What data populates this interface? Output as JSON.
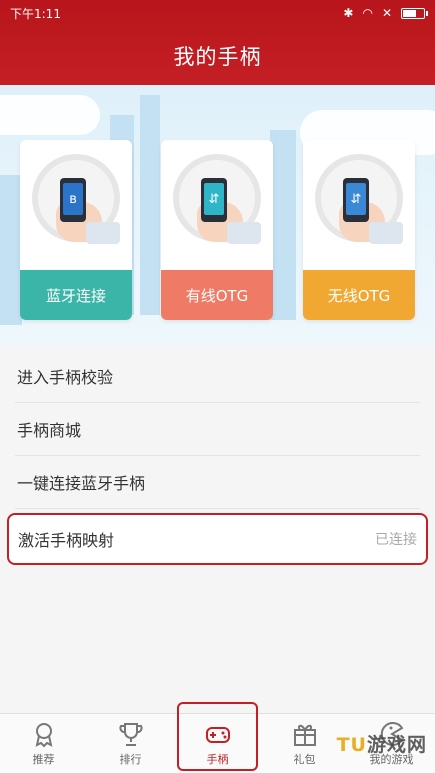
{
  "status_bar": {
    "time": "下午1:11",
    "bluetooth": "✱",
    "wifi": "◠",
    "sim": "✕"
  },
  "header": {
    "title": "我的手柄"
  },
  "cards": [
    {
      "label": "蓝牙连接",
      "icon": "bluetooth-icon",
      "glyph": "ʙ",
      "color": "#3bb5a8"
    },
    {
      "label": "有线OTG",
      "icon": "usb-icon",
      "glyph": "⇵",
      "color": "#ef7a66"
    },
    {
      "label": "无线OTG",
      "icon": "usb-icon",
      "glyph": "⇵",
      "color": "#f0a833"
    }
  ],
  "menu": [
    {
      "label": "进入手柄校验"
    },
    {
      "label": "手柄商城"
    },
    {
      "label": "一键连接蓝牙手柄"
    },
    {
      "label": "激活手柄映射",
      "status": "已连接"
    }
  ],
  "tabs": [
    {
      "label": "推荐",
      "icon": "medal-icon"
    },
    {
      "label": "排行",
      "icon": "trophy-icon"
    },
    {
      "label": "手柄",
      "icon": "gamepad-icon",
      "active": true
    },
    {
      "label": "礼包",
      "icon": "gift-icon"
    },
    {
      "label": "我的游戏",
      "icon": "pacman-icon"
    }
  ],
  "watermark": {
    "left": "TU",
    "right": "游戏网"
  },
  "colors": {
    "brand_red": "#c41f25"
  }
}
